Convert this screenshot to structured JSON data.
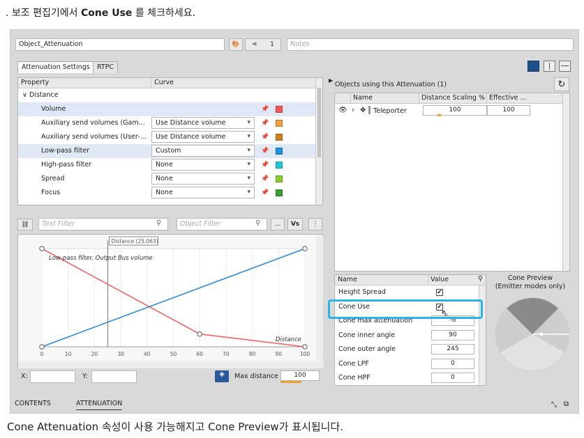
{
  "title": {
    "pre": ". 보조 편집기에서 ",
    "bold": "Cone Use",
    "post": " 를 체크하세요."
  },
  "caption": "Cone Attenuation 속성이 사용 가능해지고 Cone Preview가 표시됩니다.",
  "toolbar": {
    "object_name": "Object_Attenuation",
    "share_count": "1",
    "notes_placeholder": "Notes"
  },
  "tabs": [
    "Attenuation Settings",
    "RTPC"
  ],
  "table": {
    "headers": [
      "Property",
      "Curve"
    ],
    "group": "Distance",
    "rows": [
      {
        "property": "Volume",
        "curve": "",
        "color": "#f05656",
        "selected": true
      },
      {
        "property": "Auxiliary send volumes (Gam...",
        "curve": "Use Distance volume",
        "color": "#f0a040",
        "selected": false
      },
      {
        "property": "Auxiliary send volumes (User-...",
        "curve": "Use Distance volume",
        "color": "#d08020",
        "selected": false
      },
      {
        "property": "Low-pass filter",
        "curve": "Custom",
        "color": "#1e90e0",
        "selected": true
      },
      {
        "property": "High-pass filter",
        "curve": "None",
        "color": "#20c8d8",
        "selected": false
      },
      {
        "property": "Spread",
        "curve": "None",
        "color": "#8ccc2c",
        "selected": false
      },
      {
        "property": "Focus",
        "curve": "None",
        "color": "#3aa030",
        "selected": false
      }
    ]
  },
  "filters": {
    "text_placeholder": "Text Filter",
    "object_placeholder": "Object Filter",
    "more": "..."
  },
  "chart_data": {
    "type": "line",
    "x_ticks": [
      "0",
      "10",
      "20",
      "30",
      "40",
      "50",
      "60",
      "70",
      "80",
      "90",
      "100"
    ],
    "xlim": [
      0,
      100
    ],
    "ylim": [
      0,
      1
    ],
    "cursor": {
      "label": "Distance (25.063)",
      "x": 25.063
    },
    "series": [
      {
        "name": "Low-pass filter, Output Bus volume",
        "color": "#f06464",
        "points": [
          [
            0,
            1
          ],
          [
            60,
            0.13
          ],
          [
            100,
            0
          ]
        ]
      },
      {
        "name": "",
        "color": "#2888d0",
        "points": [
          [
            0,
            0
          ],
          [
            100,
            1
          ]
        ]
      }
    ],
    "xlabel": "Distance"
  },
  "coords": {
    "x_label": "X:",
    "y_label": "Y:",
    "max_distance_label": "Max distance",
    "max_distance": "100"
  },
  "objects": {
    "title": "Objects using this Attenuation (1)",
    "headers": [
      "Name",
      "Distance Scaling %",
      "Effective ..."
    ],
    "items": [
      {
        "name": "Teleporter",
        "scaling": "100",
        "effective": "100"
      }
    ]
  },
  "props": {
    "headers": [
      "Name",
      "Value"
    ],
    "rows": [
      {
        "name": "Height Spread",
        "type": "check",
        "value": "✔"
      },
      {
        "name": "Cone Use",
        "type": "check",
        "value": "✔"
      },
      {
        "name": "Cone max attenuation",
        "type": "num",
        "value": "-6"
      },
      {
        "name": "Cone inner angle",
        "type": "num",
        "value": "90"
      },
      {
        "name": "Cone outer angle",
        "type": "num",
        "value": "245"
      },
      {
        "name": "Cone LPF",
        "type": "num",
        "value": "0"
      },
      {
        "name": "Cone HPF",
        "type": "num",
        "value": "0"
      }
    ]
  },
  "cone_preview": {
    "title": "Cone Preview",
    "subtitle": "(Emitter modes only)"
  },
  "bottom_tabs": [
    "CONTENTS",
    "ATTENUATION"
  ],
  "colors": {
    "highlight": "#29b4e8",
    "accent_orange": "#f0a030"
  }
}
